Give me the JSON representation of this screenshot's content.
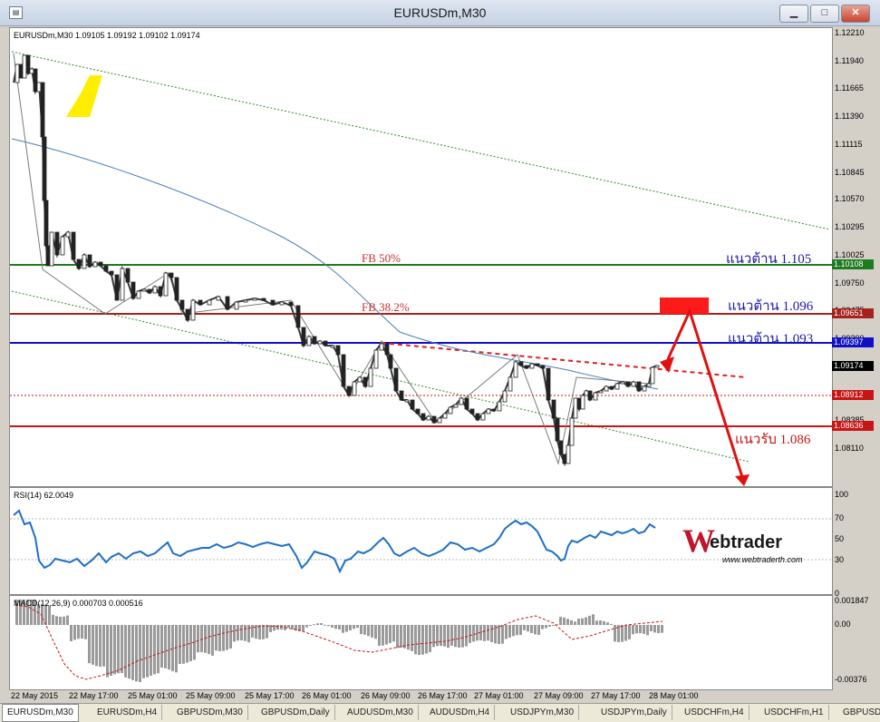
{
  "window": {
    "title": "EURUSDm,M30",
    "min_glyph": "▁",
    "max_glyph": "□",
    "close_glyph": "✕"
  },
  "chart": {
    "header": "EURUSDm,M30  1.09105 1.09192 1.09102 1.09174",
    "price_axis": [
      "1.12210",
      "1.11940",
      "1.11665",
      "1.11390",
      "1.11115",
      "1.10845",
      "1.10570",
      "1.10295",
      "1.10025",
      "1.09750",
      "1.09475",
      "1.09200",
      "1.08925",
      "1.08655",
      "1.08385",
      "1.08110"
    ],
    "price_tags": [
      {
        "value": "1.10108",
        "color": "#1e7b1e"
      },
      {
        "value": "1.09651",
        "color": "#a5231c"
      },
      {
        "value": "1.09397",
        "color": "#1010c8"
      },
      {
        "value": "1.09174",
        "color": "#000000"
      },
      {
        "value": "1.08912",
        "color": "#c81414"
      },
      {
        "value": "1.08636",
        "color": "#c81414"
      }
    ],
    "annotations": {
      "fb50": "FB 50%",
      "fb382": "FB 38.2%",
      "res1": "แนวต้าน 1.105",
      "res2": "แนวต้าน 1.096",
      "res3": "แนวต้าน 1.093",
      "sup1": "แนวรับ  1.086"
    }
  },
  "rsi": {
    "label": "RSI(14) 62.0049",
    "levels": [
      "100",
      "70",
      "50",
      "30",
      "0"
    ]
  },
  "macd": {
    "label": "MACD(12,26,9) 0.000703 0.000516",
    "levels": [
      "0.001847",
      "0.00",
      "-0.00376"
    ]
  },
  "logo": {
    "name": "Webtrader",
    "url": "www.webtraderth.com"
  },
  "time_axis": [
    "22 May 2015",
    "22 May 17:00",
    "25 May 01:00",
    "25 May 09:00",
    "25 May 17:00",
    "26 May 01:00",
    "26 May 09:00",
    "26 May 17:00",
    "27 May 01:00",
    "27 May 09:00",
    "27 May 17:00",
    "28 May 01:00"
  ],
  "tabs": [
    "EURUSDm,M30",
    "EURUSDm,H4",
    "GBPUSDm,M30",
    "GBPUSDm,Daily",
    "AUDUSDm,M30",
    "AUDUSDm,H4",
    "USDJPYm,M30",
    "USDJPYm,Daily",
    "USDCHFm,H4",
    "USDCHFm,H1",
    "GBPUSD"
  ]
}
